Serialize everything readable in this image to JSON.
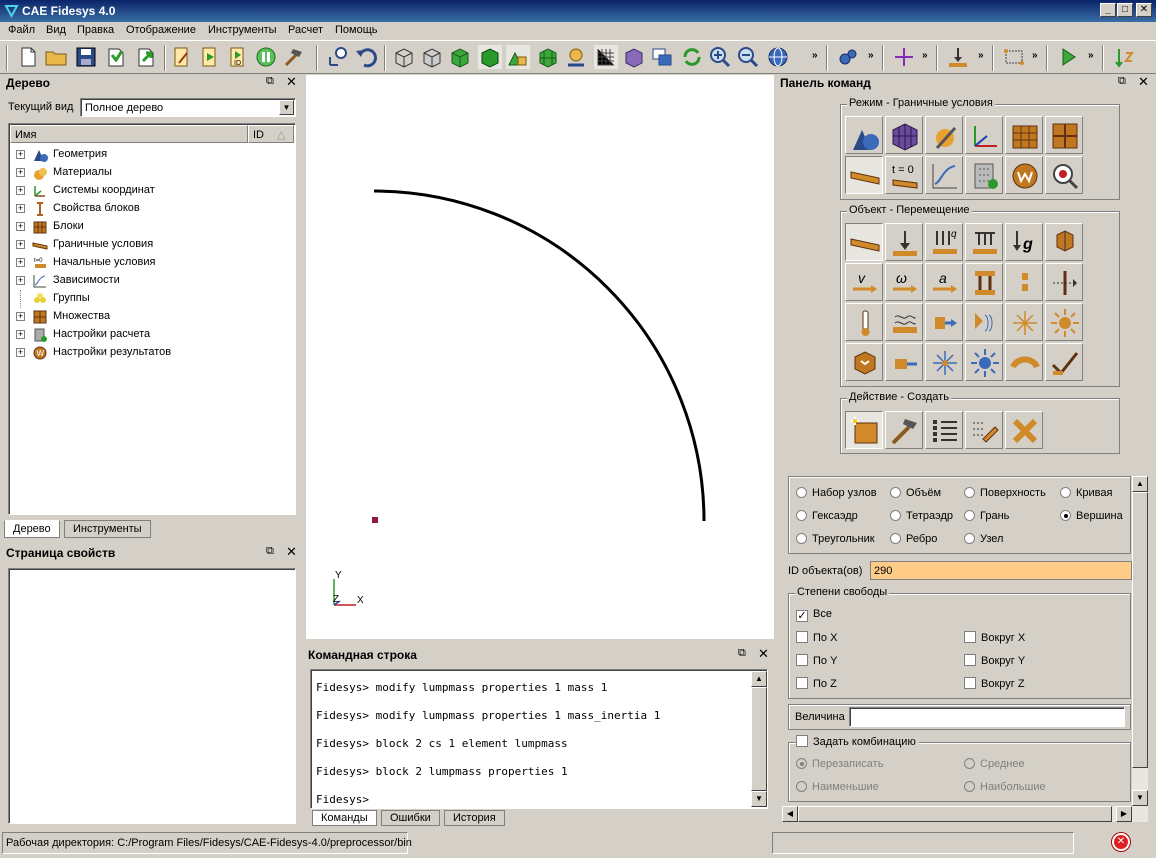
{
  "window": {
    "title": "CAE Fidesys 4.0",
    "minimize": "_",
    "maximize": "□",
    "close": "✕"
  },
  "menu": [
    "Файл",
    "Вид",
    "Правка",
    "Отображение",
    "Инструменты",
    "Расчет",
    "Помощь"
  ],
  "toolbar": {
    "overflow": "»"
  },
  "tree_panel": {
    "title": "Дерево",
    "current_view_label": "Текущий вид",
    "current_view_value": "Полное дерево",
    "col_name": "Имя",
    "col_id": "ID",
    "items": [
      {
        "label": "Геометрия",
        "icon": "geometry-icon"
      },
      {
        "label": "Материалы",
        "icon": "materials-icon"
      },
      {
        "label": "Системы координат",
        "icon": "coord-systems-icon"
      },
      {
        "label": "Свойства блоков",
        "icon": "block-properties-icon"
      },
      {
        "label": "Блоки",
        "icon": "blocks-icon"
      },
      {
        "label": "Граничные условия",
        "icon": "boundary-conditions-icon"
      },
      {
        "label": "Начальные условия",
        "icon": "initial-conditions-icon"
      },
      {
        "label": "Зависимости",
        "icon": "dependencies-icon"
      },
      {
        "label": "Группы",
        "icon": "groups-icon"
      },
      {
        "label": "Множества",
        "icon": "sets-icon"
      },
      {
        "label": "Настройки расчета",
        "icon": "calc-settings-icon"
      },
      {
        "label": "Настройки результатов",
        "icon": "results-settings-icon"
      }
    ],
    "tabs": [
      "Дерево",
      "Инструменты"
    ]
  },
  "properties_panel": {
    "title": "Страница свойств"
  },
  "viewport": {
    "axis_y": "Y",
    "axis_z": "Z",
    "axis_x": "X"
  },
  "command_panel": {
    "title": "Командная строка",
    "lines": [
      "Fidesys> modify lumpmass properties 1 mass 1",
      "Fidesys> modify lumpmass properties 1 mass_inertia 1",
      "Fidesys> block 2 cs 1 element lumpmass",
      "Fidesys> block 2 lumpmass properties 1",
      "Fidesys>"
    ],
    "tabs": [
      "Команды",
      "Ошибки",
      "История"
    ]
  },
  "status": {
    "workdir": "Рабочая директория: C:/Program Files/Fidesys/CAE-Fidesys-4.0/preprocessor/bin"
  },
  "cmd_panel": {
    "title": "Панель команд",
    "mode_group": "Режим - Граничные условия",
    "object_group": "Объект - Перемещение",
    "action_group": "Действие - Создать",
    "t0_label": "t = 0",
    "entity_radios": [
      {
        "label": "Набор узлов",
        "on": false
      },
      {
        "label": "Объём",
        "on": false
      },
      {
        "label": "Поверхность",
        "on": false
      },
      {
        "label": "Кривая",
        "on": false
      },
      {
        "label": "Гексаэдр",
        "on": false
      },
      {
        "label": "Тетраэдр",
        "on": false
      },
      {
        "label": "Грань",
        "on": false
      },
      {
        "label": "Вершина",
        "on": true
      },
      {
        "label": "Треугольник",
        "on": false
      },
      {
        "label": "Ребро",
        "on": false
      },
      {
        "label": "Узел",
        "on": false
      }
    ],
    "object_id_label": "ID объекта(ов)",
    "object_id_value": "290",
    "dof_group": "Степени свободы",
    "dof_all": "Все",
    "dof_x": "По X",
    "dof_y": "По Y",
    "dof_z": "По Z",
    "rot_x": "Вокруг X",
    "rot_y": "Вокруг Y",
    "rot_z": "Вокруг Z",
    "magnitude_label": "Величина",
    "magnitude_value": "",
    "combo_label": "Задать комбинацию",
    "combo_overwrite": "Перезаписать",
    "combo_average": "Среднее",
    "combo_min": "Наименьшие",
    "combo_max": "Наибольшие"
  },
  "colors": {
    "id_field_bg": "#ffcc88",
    "title_bar": "#0a246a",
    "accent_orange": "#d08a2a",
    "accent_green": "#3aa83a"
  }
}
